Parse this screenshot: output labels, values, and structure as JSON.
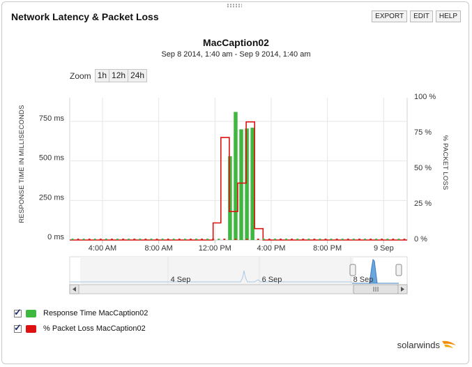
{
  "widget": {
    "title": "Network Latency & Packet Loss",
    "export_label": "EXPORT",
    "edit_label": "EDIT",
    "help_label": "HELP"
  },
  "chart_header": {
    "title": "MacCaption02",
    "subtitle": "Sep 8 2014, 1:40 am - Sep 9 2014, 1:40 am"
  },
  "zoom": {
    "label": "Zoom",
    "options": [
      "1h",
      "12h",
      "24h"
    ]
  },
  "chart_data": {
    "type": "bar",
    "xlabel": "",
    "ylabel": "RESPONSE TIME IN MILLISECONDS",
    "y2label": "% PACKET LOSS",
    "x_ticks": [
      "4:00 AM",
      "8:00 AM",
      "12:00 PM",
      "4:00 PM",
      "8:00 PM",
      "9 Sep"
    ],
    "y_ticks": [
      "0 ms",
      "250 ms",
      "500 ms",
      "750 ms"
    ],
    "y2_ticks": [
      "0 %",
      "25 %",
      "50 %",
      "75 %",
      "100 %"
    ],
    "ylim": [
      0,
      900
    ],
    "y2lim": [
      0,
      100
    ],
    "grid": true,
    "series": [
      {
        "name": "Response Time MacCaption02",
        "type": "bar",
        "color": "#3fb83f",
        "points": [
          {
            "x": 11.4,
            "y": 530
          },
          {
            "x": 11.8,
            "y": 810
          },
          {
            "x": 12.2,
            "y": 700
          },
          {
            "x": 12.6,
            "y": 705
          },
          {
            "x": 13.0,
            "y": 710
          }
        ]
      },
      {
        "name": "% Packet Loss MacCaption02",
        "type": "step",
        "color": "#dd1111",
        "points": [
          {
            "x": 0.0,
            "y": 0
          },
          {
            "x": 10.2,
            "y": 0
          },
          {
            "x": 10.2,
            "y": 12
          },
          {
            "x": 10.75,
            "y": 12
          },
          {
            "x": 10.75,
            "y": 72
          },
          {
            "x": 11.35,
            "y": 72
          },
          {
            "x": 11.35,
            "y": 20
          },
          {
            "x": 11.95,
            "y": 20
          },
          {
            "x": 11.95,
            "y": 40
          },
          {
            "x": 12.55,
            "y": 40
          },
          {
            "x": 12.55,
            "y": 83
          },
          {
            "x": 13.15,
            "y": 83
          },
          {
            "x": 13.15,
            "y": 8
          },
          {
            "x": 13.75,
            "y": 8
          },
          {
            "x": 13.75,
            "y": 0
          },
          {
            "x": 24.0,
            "y": 0
          }
        ]
      }
    ]
  },
  "navigator": {
    "labels": [
      "4 Sep",
      "6 Sep",
      "8 Sep"
    ]
  },
  "legend": {
    "items": [
      {
        "label": "Response Time MacCaption02",
        "color": "#3fb83f"
      },
      {
        "label": "% Packet Loss MacCaption02",
        "color": "#dd1111"
      }
    ]
  },
  "brand": {
    "logo_text": "solarwinds",
    "accent": "#f28b00"
  }
}
